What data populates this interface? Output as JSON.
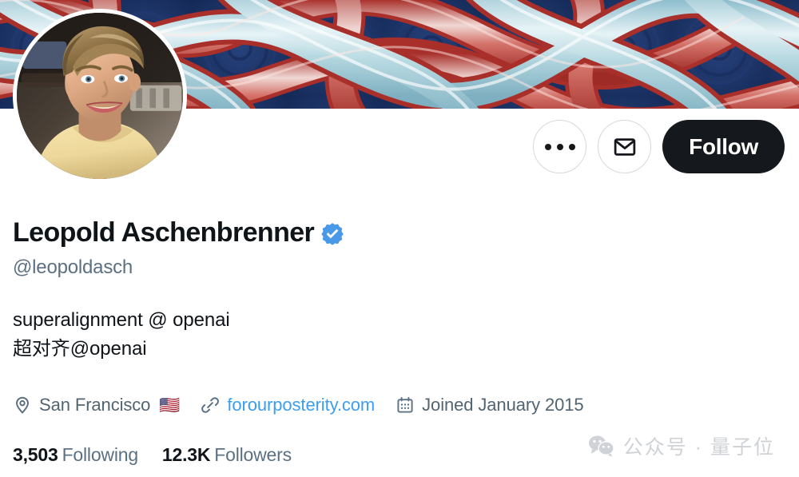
{
  "banner": {
    "alt": "celtic-knot-pattern-banner",
    "colors": {
      "navy": "#1d3566",
      "navy_dark": "#152a57",
      "light_blue": "#aed4de",
      "pale_blue": "#d8ecf1",
      "red": "#b5352f",
      "coral": "#d4736a",
      "white_stripe": "#f2f2f0"
    }
  },
  "avatar": {
    "alt": "profile-photo-leopold-aschenbrenner",
    "ring_color": "#ffffff"
  },
  "actions": {
    "more_label": "More",
    "message_label": "Message",
    "follow_label": "Follow",
    "follow_bg": "#15181c",
    "follow_text_color": "#ffffff"
  },
  "profile": {
    "display_name": "Leopold Aschenbrenner",
    "verified": true,
    "verified_color": "#4a99e9",
    "handle": "@leopoldasch",
    "bio_lines": [
      "superalignment @ openai",
      "超对齐@openai"
    ]
  },
  "meta": {
    "location": "San Francisco",
    "location_flag": "🇺🇸",
    "website": "forourposterity.com",
    "website_color": "#3b9ef0",
    "joined": "Joined January 2015",
    "icons": {
      "location": "map-pin-icon",
      "website": "link-icon",
      "joined": "calendar-icon"
    }
  },
  "stats": [
    {
      "count": "3,503",
      "label": "Following"
    },
    {
      "count": "12.3K",
      "label": "Followers"
    }
  ],
  "watermark": {
    "icon": "wechat-icon",
    "text": "公众号 · 量子位",
    "color": "#cfd2d6"
  }
}
